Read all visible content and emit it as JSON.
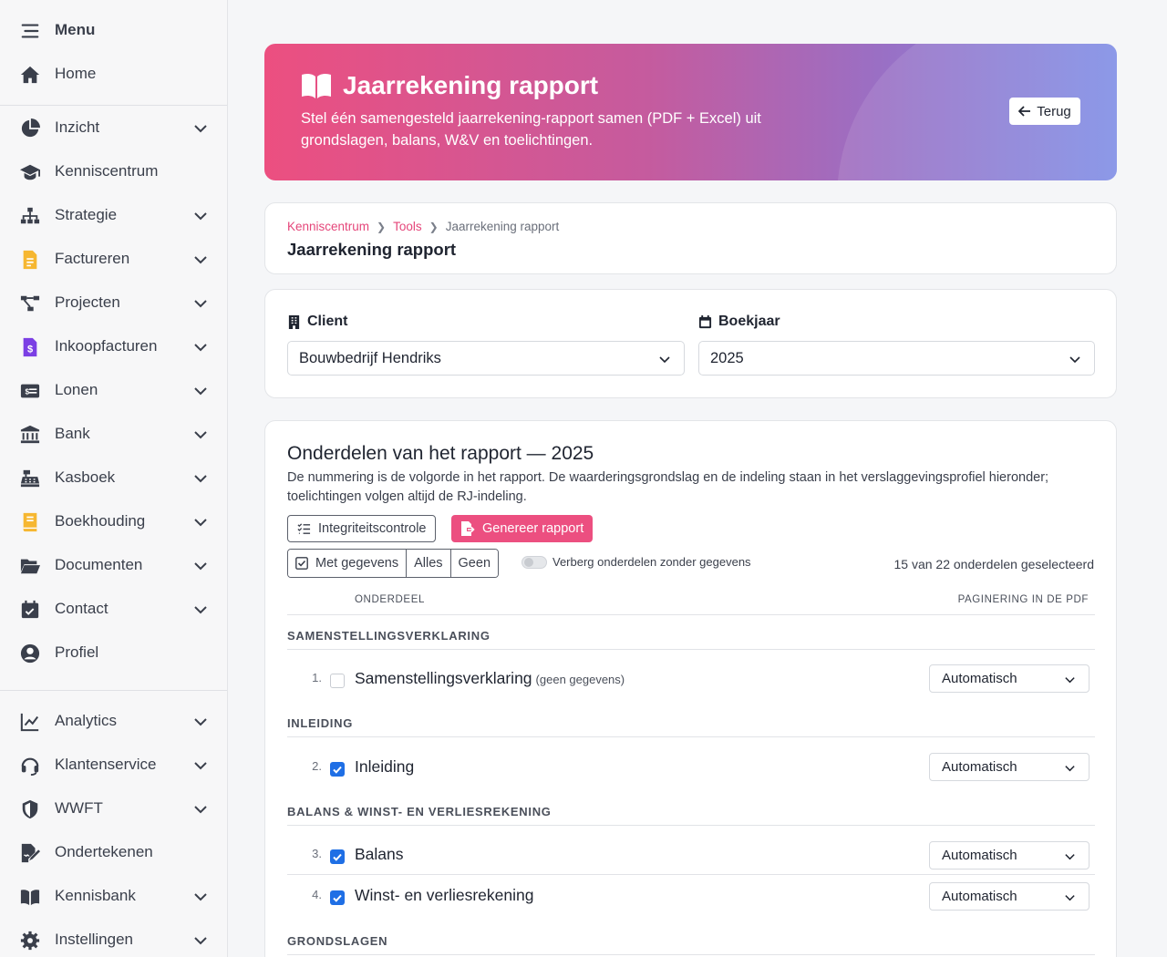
{
  "sidebar": {
    "menu_label": "Menu",
    "home_label": "Home",
    "items": [
      {
        "label": "Inzicht"
      },
      {
        "label": "Kenniscentrum"
      },
      {
        "label": "Strategie"
      },
      {
        "label": "Factureren"
      },
      {
        "label": "Projecten"
      },
      {
        "label": "Inkoopfacturen"
      },
      {
        "label": "Lonen"
      },
      {
        "label": "Bank"
      },
      {
        "label": "Kasboek"
      },
      {
        "label": "Boekhouding"
      },
      {
        "label": "Documenten"
      },
      {
        "label": "Contact"
      },
      {
        "label": "Profiel"
      }
    ],
    "bottom_items": [
      {
        "label": "Analytics"
      },
      {
        "label": "Klantenservice"
      },
      {
        "label": "WWFT"
      },
      {
        "label": "Ondertekenen"
      },
      {
        "label": "Kennisbank"
      },
      {
        "label": "Instellingen"
      }
    ]
  },
  "hero": {
    "title": "Jaarrekening rapport",
    "subtitle": "Stel één samengesteld jaarrekening-rapport samen (PDF + Excel) uit grondslagen, balans, W&V en toelichtingen.",
    "back_label": "Terug"
  },
  "breadcrumb": {
    "items": [
      "Kenniscentrum",
      "Tools"
    ],
    "current": "Jaarrekening rapport",
    "title": "Jaarrekening rapport"
  },
  "filters": {
    "client_label": "Client",
    "client_value": "Bouwbedrijf Hendriks",
    "year_label": "Boekjaar",
    "year_value": "2025"
  },
  "report": {
    "title": "Onderdelen van het rapport — 2025",
    "description": "De nummering is de volgorde in het rapport. De waarderingsgrondslag en de indeling staan in het verslaggevingsprofiel hieronder; toelichtingen volgen altijd de RJ-indeling.",
    "integrity_label": "Integriteitscontrole",
    "generate_label": "Genereer rapport",
    "filter_with_data": "Met gegevens",
    "filter_all": "Alles",
    "filter_none": "Geen",
    "hide_empty_label": "Verberg onderdelen zonder gegevens",
    "selected_count": "15 van 22 onderdelen geselecteerd",
    "col_section": "ONDERDEEL",
    "col_pagination": "PAGINERING IN DE PDF",
    "groups": [
      {
        "title": "SAMENSTELLINGSVERKLARING"
      },
      {
        "title": "INLEIDING"
      },
      {
        "title": "BALANS & WINST- EN VERLIESREKENING"
      },
      {
        "title": "GRONDSLAGEN"
      }
    ],
    "rows": [
      {
        "num": "1.",
        "label": "Samenstellingsverklaring",
        "note": "(geen gegevens)",
        "checked": false,
        "pagination": "Automatisch"
      },
      {
        "num": "2.",
        "label": "Inleiding",
        "note": "",
        "checked": true,
        "pagination": "Automatisch"
      },
      {
        "num": "3.",
        "label": "Balans",
        "note": "",
        "checked": true,
        "pagination": "Automatisch"
      },
      {
        "num": "4.",
        "label": "Winst- en verliesrekening",
        "note": "",
        "checked": true,
        "pagination": "Automatisch"
      }
    ]
  },
  "colors": {
    "accent": "#ec4f80",
    "checkbox": "#1f6fe5"
  }
}
